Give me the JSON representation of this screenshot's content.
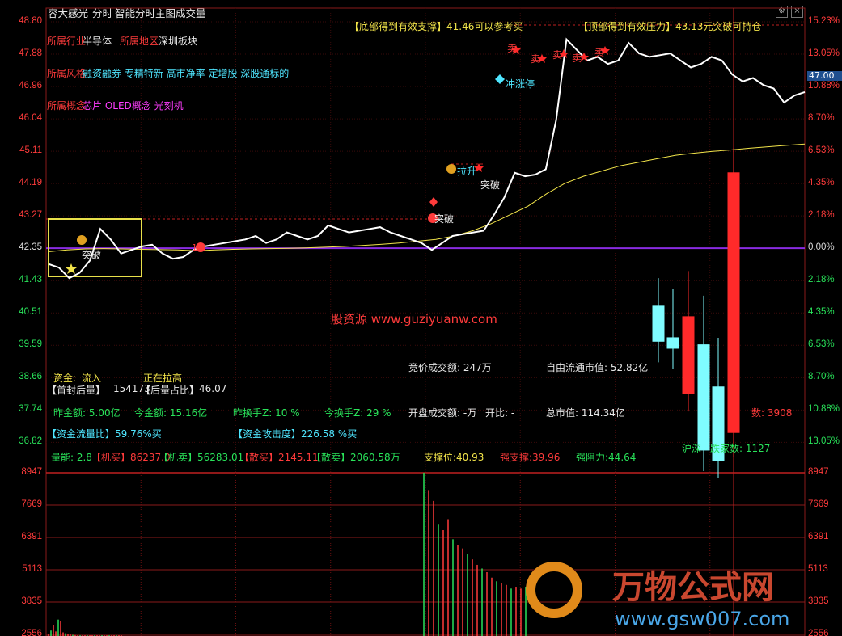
{
  "header": {
    "stock_name": "容大感光",
    "tab_intraday": "分时",
    "tab_main": "智能分时主图",
    "tab_volume": "成交量",
    "settings_icon": "gear-icon",
    "close_icon": "close-icon"
  },
  "price_axis_left": [
    "48.80",
    "47.88",
    "46.96",
    "46.04",
    "45.11",
    "44.19",
    "43.27",
    "42.35",
    "41.43",
    "40.51",
    "39.59",
    "38.66",
    "37.74",
    "36.82"
  ],
  "price_axis_right": [
    "15.23%",
    "13.05%",
    "10.88%",
    "8.70%",
    "6.53%",
    "4.35%",
    "2.18%",
    "0.00%",
    "2.18%",
    "4.35%",
    "6.53%",
    "8.70%",
    "10.88%",
    "13.05%"
  ],
  "current_price_tag": "47.00",
  "volume_axis_left": [
    "8947",
    "7669",
    "6391",
    "5113",
    "3835",
    "2556"
  ],
  "volume_axis_right": [
    "8947",
    "7669",
    "6391",
    "5113",
    "3835",
    "2556"
  ],
  "info": {
    "industry_label": "所属行业",
    "industry_value": "半导体",
    "region_label": "所属地区",
    "region_value": "深圳板块",
    "style_label": "所属风格",
    "style_value": "融资融券 专精特新 高市净率 定增股 深股通标的",
    "concept_label": "所属概念",
    "concept_value": "芯片 OLED概念 光刻机"
  },
  "signals": {
    "bottom_support": "【底部得到有效支撑】41.46可以参考买",
    "top_pressure": "【顶部得到有效压力】43.13元突破可持仓",
    "breakout_1": "突破",
    "breakout_2": "突破",
    "breakout_3": "突破",
    "pull_up": "拉升",
    "rush_limit": "冲涨停",
    "sell_1": "卖",
    "sell_2": "卖",
    "sell_3": "卖",
    "sell_4": "卖",
    "sell_5": "卖",
    "marker_1": "1"
  },
  "watermark": {
    "site_text": "股资源 www.guziyuanw.com",
    "brand_cn": "万物公式网",
    "brand_url": "www.gsw007.com"
  },
  "stats": {
    "fund_label": "资金:",
    "fund_value": "流入",
    "pulling_up": "正在拉高",
    "seal_label": "【首封后量】",
    "seal_value": "154173",
    "seal_ratio_label": "【后量占比】",
    "seal_ratio_value": "46.07",
    "auction_amount": "竞价成交额: 247万",
    "float_mktcap": "自由流通市值: 52.82亿",
    "yest_amount": "昨金额: 5.00亿",
    "today_amount": "今金额: 15.16亿",
    "yest_turnover": "昨换手Z: 10 %",
    "today_turnover": "今换手Z: 29 %",
    "open_amount": "开盘成交额: -万",
    "open_ratio": "开比: -",
    "total_mktcap": "总市值: 114.34亿",
    "flow_ratio": "【资金流量比】59.76%买",
    "attack": "【资金攻击度】226.58 %买",
    "vol_ratio": "量能: 2.8",
    "inst_buy": "【机买】86237.0",
    "inst_sell": "【机卖】56283.01",
    "retail_buy": "【散买】2145.11",
    "retail_sell": "【散卖】2060.58万",
    "support": "支撑位:40.93",
    "strong_support": "强支撑:39.96",
    "strong_resist": "强阻力:44.64",
    "up_count": "数: 3908",
    "down_count": "跌家数: 1127",
    "shanghai": "沪深"
  },
  "chart_data": {
    "type": "line",
    "title": "",
    "xlabel": "",
    "ylabel": "",
    "ylim": [
      36.82,
      48.8
    ],
    "prev_close": 42.35,
    "series": [
      {
        "values": [
          41.9,
          41.8,
          41.5,
          41.65,
          42.0,
          42.9,
          42.6,
          42.2,
          42.3,
          42.4,
          42.45,
          42.2,
          42.05,
          42.1,
          42.3,
          42.4,
          42.45,
          42.5,
          42.55,
          42.6,
          42.7,
          42.5,
          42.6,
          42.8,
          42.7,
          42.6,
          42.7,
          43.0,
          42.9,
          42.8,
          42.85,
          42.9,
          42.95,
          42.8,
          42.7,
          42.6,
          42.5,
          42.3,
          42.5,
          42.7,
          42.75,
          42.8,
          42.85,
          43.3,
          43.8,
          44.5,
          44.4,
          44.45,
          44.6,
          46.0,
          48.3,
          48.0,
          47.7,
          47.8,
          47.6,
          47.7,
          48.2,
          47.9,
          47.8,
          47.85,
          47.9,
          47.7,
          47.5,
          47.6,
          47.8,
          47.7,
          47.3,
          47.1,
          47.2,
          47.0,
          46.9,
          46.5,
          46.7,
          46.8
        ]
      },
      {
        "values": [
          42.25,
          42.3,
          42.33,
          42.34,
          42.33,
          42.32,
          42.31,
          42.3,
          42.28,
          42.3,
          42.32,
          42.33,
          42.34,
          42.35,
          42.36,
          42.38,
          42.4,
          42.43,
          42.46,
          42.5,
          42.55,
          42.6,
          42.7,
          42.85,
          43.05,
          43.3,
          43.55,
          43.9,
          44.2,
          44.4,
          44.55,
          44.7,
          44.8,
          44.9,
          45.0,
          45.06,
          45.11,
          45.15,
          45.2,
          45.24,
          45.28,
          45.32
        ]
      }
    ],
    "candles": [
      {
        "open": 40.7,
        "close": 39.7,
        "high": 41.5,
        "low": 39.1
      },
      {
        "open": 39.8,
        "close": 39.5,
        "high": 41.2,
        "low": 38.9
      },
      {
        "open": 38.2,
        "close": 40.4,
        "high": 41.7,
        "low": 37.7
      },
      {
        "open": 39.6,
        "close": 36.6,
        "high": 41.0,
        "low": 36.0
      },
      {
        "open": 38.4,
        "close": 36.3,
        "high": 39.8,
        "low": 35.8
      },
      {
        "open": 37.1,
        "close": 44.5,
        "high": 45.2,
        "low": 36.4
      }
    ],
    "volume": [
      120,
      300,
      600,
      250,
      900,
      800,
      200,
      150,
      100,
      80,
      60,
      50,
      40,
      40,
      40,
      40,
      40,
      40,
      40,
      40,
      40,
      40,
      40,
      40,
      40,
      40,
      40,
      40,
      40,
      40,
      40,
      8947,
      8000,
      7400,
      6100,
      5800,
      6400,
      5300,
      5000,
      4800,
      4500,
      4200,
      3900,
      3700,
      3500,
      3200,
      3000,
      2900,
      2800,
      2600,
      2700,
      2600,
      2700
    ]
  }
}
